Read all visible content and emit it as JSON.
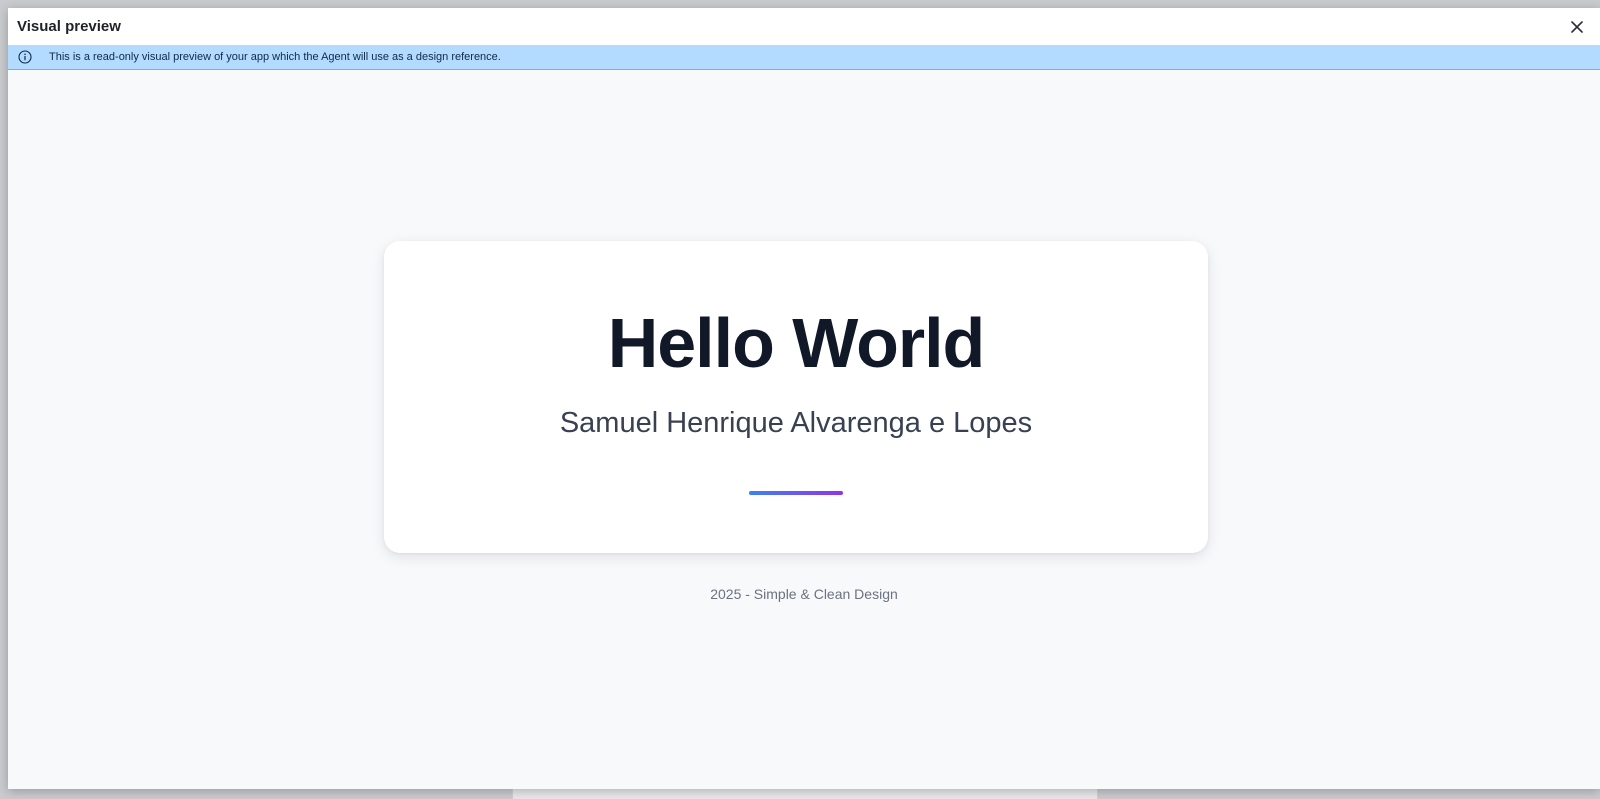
{
  "window": {
    "title": "Visual preview",
    "close_icon": "close-icon"
  },
  "banner": {
    "icon": "info-icon",
    "text": "This is a read-only visual preview of your app which the Agent will use as a design reference.",
    "color": "#b3dbff"
  },
  "card": {
    "heading": "Hello World",
    "subtitle": "Samuel Henrique Alvarenga e Lopes",
    "divider_gradient": [
      "#3b82f6",
      "#9333ea"
    ]
  },
  "footer": {
    "text": "2025 - Simple & Clean Design"
  }
}
